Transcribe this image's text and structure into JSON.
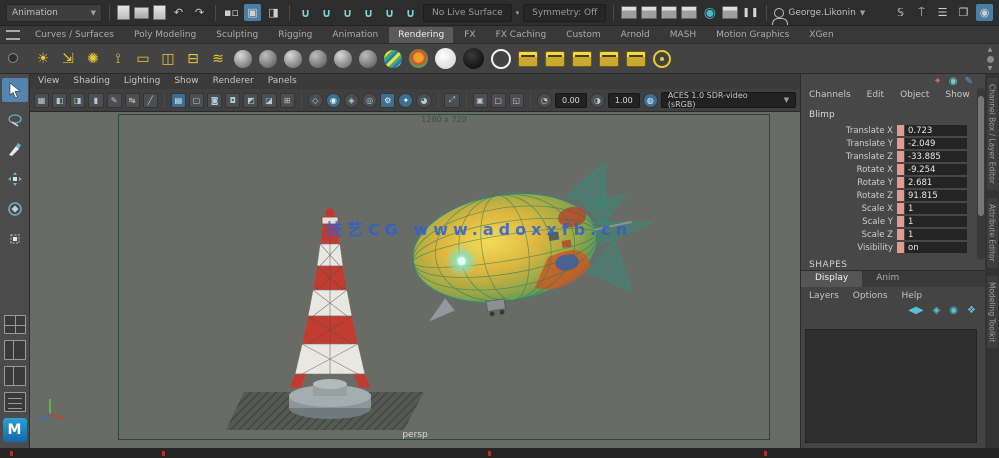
{
  "status_bar": {
    "menuset_label": "Animation",
    "no_live_surface_label": "No Live Surface",
    "symmetry_label": "Symmetry: Off",
    "user_label": "George.Likonin",
    "undo_glyph": "↶",
    "redo_glyph": "↷",
    "record_glyph": "◉",
    "pause_glyph": "❚❚",
    "dropdown_glyph": "▼"
  },
  "shelf_tabs": [
    "Curves / Surfaces",
    "Poly Modeling",
    "Sculpting",
    "Rigging",
    "Animation",
    "Rendering",
    "FX",
    "FX Caching",
    "Custom",
    "Arnold",
    "MASH",
    "Motion Graphics",
    "XGen"
  ],
  "panel_menus": [
    "View",
    "Shading",
    "Lighting",
    "Show",
    "Renderer",
    "Panels"
  ],
  "panel_toolbar": {
    "exposure_value": "0.00",
    "gamma_value": "1.00",
    "colorspace_value": "ACES 1.0 SDR-video (sRGB)",
    "dropdown_glyph": "▼"
  },
  "viewport": {
    "resolution_label": "1280 x 720",
    "camera_label": "persp",
    "watermark_text": "技艺CG www.adoxxfb.cn"
  },
  "channel_box": {
    "menus": [
      "Channels",
      "Edit",
      "Object",
      "Show"
    ],
    "object_name": "Blimp",
    "rows": [
      {
        "label": "Translate X",
        "value": "0.723"
      },
      {
        "label": "Translate Y",
        "value": "-2.049"
      },
      {
        "label": "Translate Z",
        "value": "-33.885"
      },
      {
        "label": "Rotate X",
        "value": "-9.254"
      },
      {
        "label": "Rotate Y",
        "value": "2.681"
      },
      {
        "label": "Rotate Z",
        "value": "91.815"
      },
      {
        "label": "Scale X",
        "value": "1"
      },
      {
        "label": "Scale Y",
        "value": "1"
      },
      {
        "label": "Scale Z",
        "value": "1"
      },
      {
        "label": "Visibility",
        "value": "on"
      }
    ],
    "shapes_label": "SHAPES"
  },
  "layer_editor": {
    "tabs": [
      "Display",
      "Anim"
    ],
    "menus": [
      "Layers",
      "Options",
      "Help"
    ]
  },
  "side_tabs": [
    "Channel Box / Layer Editor",
    "Attribute Editor",
    "Modeling Toolkit"
  ],
  "colors": {
    "accent_blue": "#5285b0",
    "salmon": "#e49a8c",
    "shelf_yellow": "#e9c832",
    "wire_teal": "#2e8f7b"
  }
}
